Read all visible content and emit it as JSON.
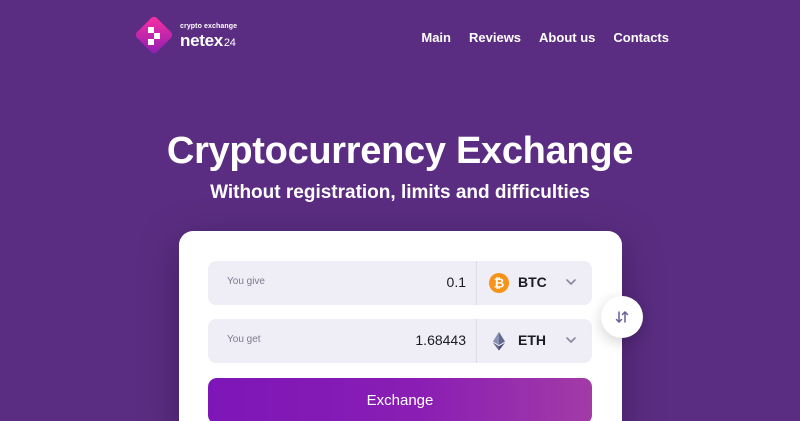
{
  "brand": {
    "tagline": "crypto exchange",
    "name": "netex",
    "number": "24"
  },
  "nav": {
    "items": [
      {
        "label": "Main"
      },
      {
        "label": "Reviews"
      },
      {
        "label": "About us"
      },
      {
        "label": "Contacts"
      }
    ]
  },
  "hero": {
    "title": "Cryptocurrency Exchange",
    "subtitle": "Without registration, limits and difficulties"
  },
  "exchange": {
    "give": {
      "label": "You give",
      "amount": "0.1",
      "currency": "BTC",
      "icon": "bitcoin-icon"
    },
    "get": {
      "label": "You get",
      "amount": "1.68443",
      "currency": "ETH",
      "icon": "ethereum-icon"
    },
    "button_label": "Exchange",
    "swap_icon": "swap-arrows-icon"
  },
  "colors": {
    "background": "#5b2d82",
    "accent": "#8a1eb4",
    "bitcoin": "#f7931a"
  }
}
